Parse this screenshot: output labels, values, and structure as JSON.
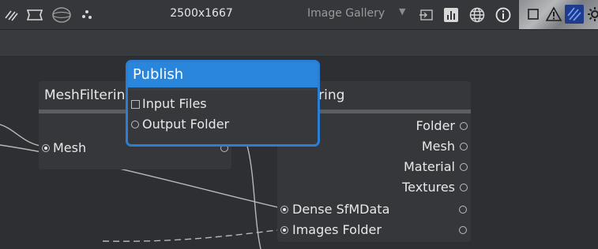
{
  "toolbar": {
    "icons": [
      "hatch-icon",
      "frame-icon",
      "sphere-icon",
      "points-icon"
    ],
    "resolution": "2500x1667",
    "gallery_select": {
      "value": "Image Gallery"
    },
    "right_icons": [
      "import-icon",
      "chart-icon",
      "globe-icon",
      "info-icon"
    ],
    "thumb_buttons": [
      "square-icon",
      "warning-icon",
      "hatch-active-icon",
      "gear-icon"
    ]
  },
  "graph": {
    "mesh_filtering": {
      "title": "MeshFiltering",
      "ports_in": [
        "Mesh"
      ]
    },
    "texturing": {
      "title": "Texturing",
      "ports_out": [
        "Folder",
        "Mesh",
        "Material",
        "Textures"
      ],
      "ports_in": [
        "Dense SfMData",
        "Images Folder"
      ]
    },
    "publish": {
      "title": "Publish",
      "ports_in": [
        "Input Files",
        "Output Folder"
      ]
    }
  },
  "colors": {
    "accent": "#2a86db",
    "node_bg": "#36373b",
    "canvas_bg": "#2e2f33"
  }
}
